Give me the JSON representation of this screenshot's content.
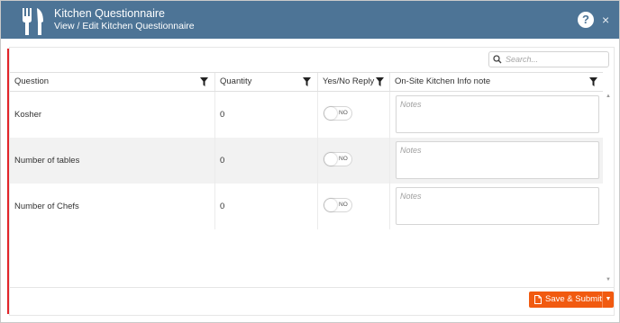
{
  "window": {
    "title": "Kitchen Questionnaire",
    "subtitle": "View / Edit Kitchen Questionnaire",
    "help_label": "?",
    "close_label": "×",
    "header_color": "#4d7496",
    "accent_color": "#f15a10"
  },
  "search": {
    "placeholder": "Search..."
  },
  "table": {
    "columns": [
      "Question",
      "Quantity",
      "Yes/No Reply",
      "On-Site Kitchen Info note"
    ],
    "rows": [
      {
        "question": "Kosher",
        "quantity": "0",
        "reply": "NO",
        "notes_placeholder": "Notes"
      },
      {
        "question": "Number of tables",
        "quantity": "0",
        "reply": "NO",
        "notes_placeholder": "Notes"
      },
      {
        "question": "Number of Chefs",
        "quantity": "0",
        "reply": "NO",
        "notes_placeholder": "Notes"
      }
    ]
  },
  "footer": {
    "save_label": "Save & Submit",
    "dropdown_glyph": "▼"
  }
}
